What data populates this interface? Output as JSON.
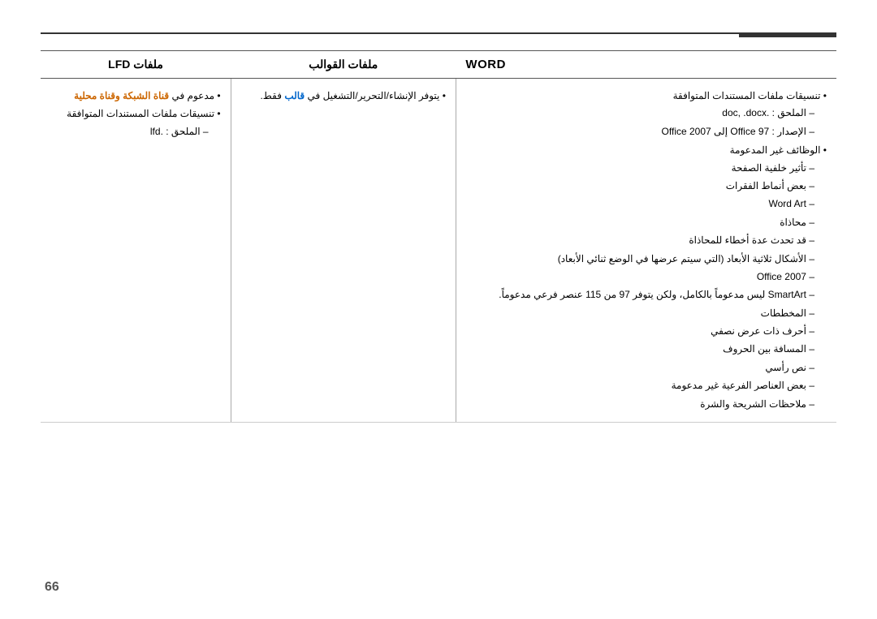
{
  "page": {
    "number": "66",
    "top_accent_color": "#333333"
  },
  "table": {
    "headers": {
      "word": "WORD",
      "templates": "ملفات القوالب",
      "lfd": "ملفات LFD"
    },
    "word_col": {
      "items": [
        {
          "bullet": "تنسيقات ملفات المستندات المتوافقة",
          "subitems": [
            "الملحق : .doc, .docx",
            "الإصدار : Office 97 إلى Office 2007"
          ]
        },
        {
          "bullet": "الوظائف غير المدعومة",
          "subitems": [
            "تأثير خلفية الصفحة",
            "بعض أنماط الفقرات",
            "Word Art",
            "محاذاة",
            "قد تحدث عدة أخطاء للمحاذاة",
            "الأشكال ثلاثية الأبعاد (التي سيتم عرضها في الوضع ثنائي الأبعاد)",
            "Office 2007",
            "SmartArt ليس مدعوماً بالكامل، ولكن يتوفر 97 من 115 عنصر فرعي مدعوماً.",
            "المخططات",
            "أحرف ذات عرض نصفي",
            "المسافة بين الحروف",
            "نص رأسي",
            "بعض العناصر الفرعية غير مدعومة",
            "ملاحظات الشريحة والشرة"
          ]
        }
      ]
    },
    "templates_col": {
      "items": [
        {
          "bullet": "يتوفر الإنشاء/التحرير/التشغيل في قالب فقط.",
          "highlight_word": "قالب",
          "highlight_color": "blue"
        }
      ]
    },
    "lfd_col": {
      "items": [
        {
          "bullet": "مدعوم في قناة الشبكة وقناة محلية",
          "highlight_phrase": "قناة الشبكة وقناة محلية",
          "highlight_color": "orange"
        },
        {
          "bullet": "تنسيقات ملفات المستندات المتوافقة",
          "subitems": [
            "الملحق : .lfd"
          ]
        }
      ]
    }
  }
}
